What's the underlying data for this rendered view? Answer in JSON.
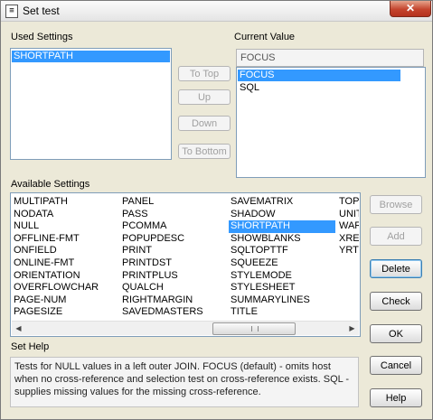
{
  "window": {
    "title": "Set test",
    "icon": "document-icon",
    "close_glyph": "✕"
  },
  "used_settings": {
    "label": "Used Settings",
    "items": [
      {
        "label": "SHORTPATH",
        "selected": true
      }
    ]
  },
  "current_value": {
    "label": "Current Value",
    "field_value": "FOCUS",
    "options": [
      {
        "label": "FOCUS",
        "selected": true
      },
      {
        "label": "SQL",
        "selected": false
      }
    ]
  },
  "move_buttons": {
    "to_top": "To Top",
    "up": "Up",
    "down": "Down",
    "to_bottom": "To Bottom"
  },
  "available_settings": {
    "label": "Available Settings",
    "columns": [
      [
        "MULTIPATH",
        "NODATA",
        "NULL",
        "OFFLINE-FMT",
        "ONFIELD",
        "ONLINE-FMT",
        "ORIENTATION",
        "OVERFLOWCHAR",
        "PAGE-NUM",
        "PAGESIZE"
      ],
      [
        "PANEL",
        "PASS",
        "PCOMMA",
        "POPUPDESC",
        "PRINT",
        "PRINTDST",
        "PRINTPLUS",
        "QUALCH",
        "RIGHTMARGIN",
        "SAVEDMASTERS"
      ],
      [
        "SAVEMATRIX",
        "SHADOW",
        "SHORTPATH",
        "SHOWBLANKS",
        "SQLTOPTTF",
        "SQUEEZE",
        "STYLEMODE",
        "STYLESHEET",
        "SUMMARYLINES",
        "TITLE"
      ],
      [
        "TOPM",
        "UNIT",
        "WAR",
        "XRET",
        "YRTH",
        "",
        "",
        "",
        "",
        ""
      ]
    ],
    "selected": "SHORTPATH"
  },
  "side_buttons": {
    "browse": "Browse",
    "add": "Add",
    "delete": "Delete",
    "check": "Check",
    "ok": "OK",
    "cancel": "Cancel",
    "help": "Help"
  },
  "set_help": {
    "label": "Set Help",
    "text": "Tests for NULL values in a left outer JOIN. FOCUS (default) - omits host when no cross-reference and selection test on cross-reference exists. SQL - supplies missing values for the missing cross-reference."
  },
  "scrollbar": {
    "left_arrow": "◀",
    "right_arrow": "▶",
    "left_icon": "arrow-left-icon",
    "right_icon": "arrow-right-icon"
  },
  "colors": {
    "selection": "#3399ff",
    "dialog_bg": "#ece9d8",
    "close_button": "#c4442d"
  }
}
